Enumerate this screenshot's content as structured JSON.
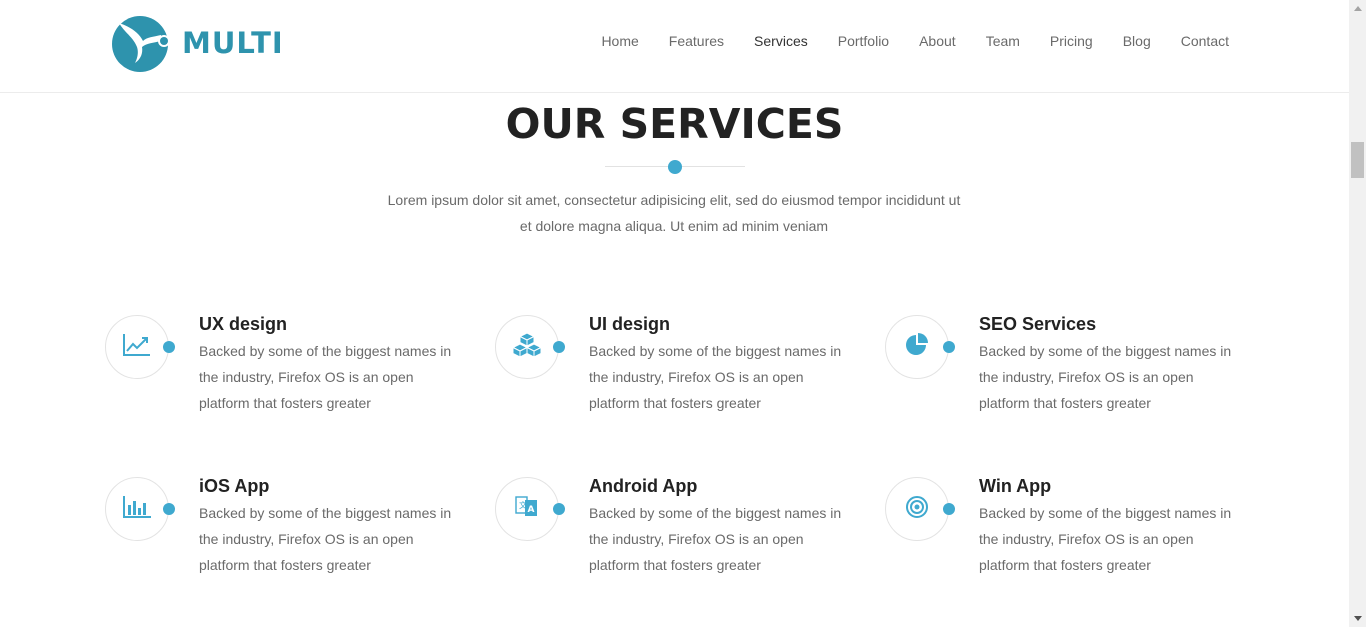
{
  "brand": {
    "name": "MULTI",
    "color": "#2e93ad"
  },
  "nav": {
    "items": [
      {
        "label": "Home"
      },
      {
        "label": "Features"
      },
      {
        "label": "Services"
      },
      {
        "label": "Portfolio"
      },
      {
        "label": "About"
      },
      {
        "label": "Team"
      },
      {
        "label": "Pricing"
      },
      {
        "label": "Blog"
      },
      {
        "label": "Contact"
      }
    ]
  },
  "section": {
    "title": "OUR SERVICES",
    "description_line1": "Lorem ipsum dolor sit amet, consectetur adipisicing elit, sed do eiusmod tempor incididunt ut",
    "description_line2": "et dolore magna aliqua. Ut enim ad minim veniam"
  },
  "accent_color": "#3fa9cf",
  "services": [
    {
      "title": "UX design",
      "icon": "line-chart-icon",
      "text_line1": "Backed by some of the biggest names in",
      "text_line2": "the industry, Firefox OS is an open",
      "text_line3": "platform that fosters greater"
    },
    {
      "title": "UI design",
      "icon": "cubes-icon",
      "text_line1": "Backed by some of the biggest names in",
      "text_line2": "the industry, Firefox OS is an open",
      "text_line3": "platform that fosters greater"
    },
    {
      "title": "SEO Services",
      "icon": "pie-chart-icon",
      "text_line1": "Backed by some of the biggest names in",
      "text_line2": "the industry, Firefox OS is an open",
      "text_line3": "platform that fosters greater"
    },
    {
      "title": "iOS App",
      "icon": "bar-chart-icon",
      "text_line1": "Backed by some of the biggest names in",
      "text_line2": "the industry, Firefox OS is an open",
      "text_line3": "platform that fosters greater"
    },
    {
      "title": "Android App",
      "icon": "translate-icon",
      "text_line1": "Backed by some of the biggest names in",
      "text_line2": "the industry, Firefox OS is an open",
      "text_line3": "platform that fosters greater"
    },
    {
      "title": "Win App",
      "icon": "target-icon",
      "text_line1": "Backed by some of the biggest names in",
      "text_line2": "the industry, Firefox OS is an open",
      "text_line3": "platform that fosters greater"
    }
  ]
}
